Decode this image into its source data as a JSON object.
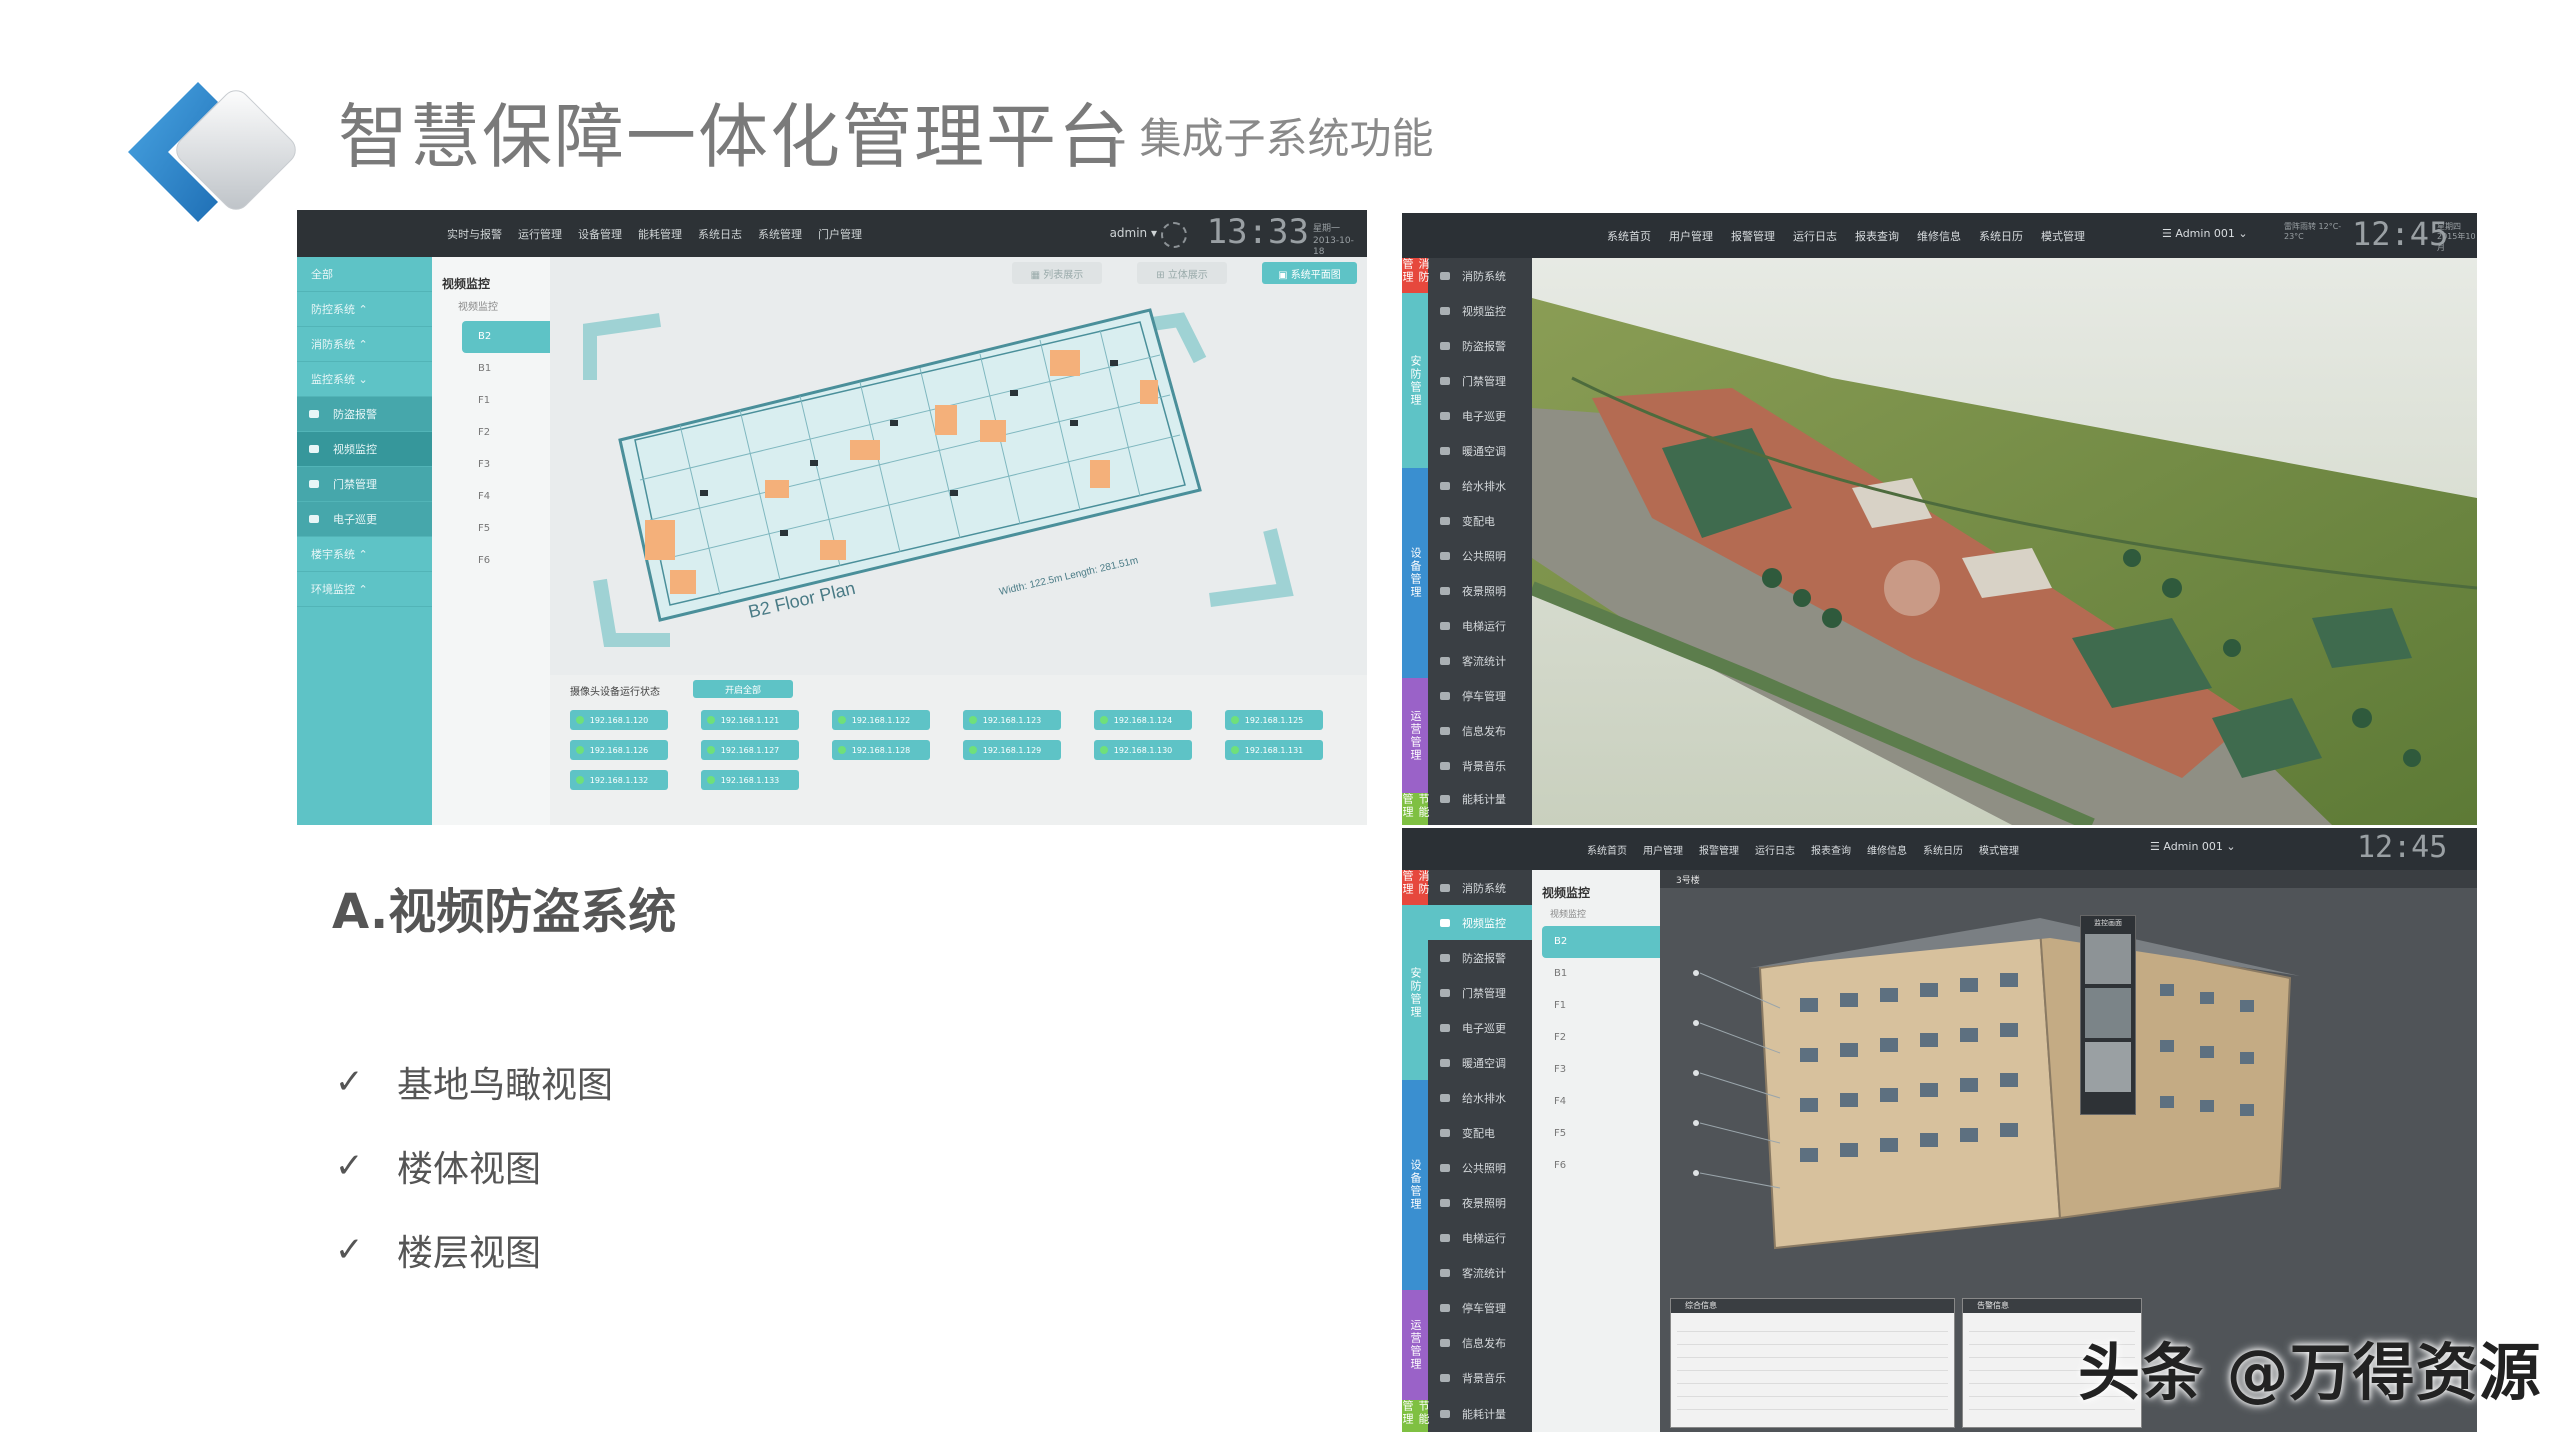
{
  "slide": {
    "title": "智慧保障一体化管理平台",
    "subtitle": "- 集成子系统功能",
    "section_heading": "A.视频防盗系统",
    "bullets": [
      {
        "check": "✓",
        "text": "基地鸟瞰视图"
      },
      {
        "check": "✓",
        "text": "楼体视图"
      },
      {
        "check": "✓",
        "text": "楼层视图"
      }
    ],
    "watermark": "头条 @万得资源",
    "colors": {
      "teal": "#5ec3c6",
      "logo_blue": "#3a8fd0",
      "dark_bar": "#2d3236"
    }
  },
  "shot1": {
    "menu": [
      "实时与报警",
      "运行管理",
      "设备管理",
      "能耗管理",
      "系统日志",
      "系统管理",
      "门户管理"
    ],
    "admin": "admin ▾",
    "time": "13:33",
    "date": "星期一 2013-10-18",
    "sidebar": [
      {
        "label": "全部",
        "type": "top"
      },
      {
        "label": "防控系统 ⌃",
        "type": "top"
      },
      {
        "label": "消防系统 ⌃",
        "type": "top"
      },
      {
        "label": "监控系统 ⌄",
        "type": "top"
      },
      {
        "label": "防盗报警",
        "type": "sub"
      },
      {
        "label": "视频监控",
        "type": "active"
      },
      {
        "label": "门禁管理",
        "type": "sub"
      },
      {
        "label": "电子巡更",
        "type": "sub"
      },
      {
        "label": "楼宇系统 ⌃",
        "type": "top"
      },
      {
        "label": "环境监控 ⌃",
        "type": "top"
      }
    ],
    "floors_header": "视频监控",
    "floors_subheader": "视频监控",
    "floors": [
      "B2",
      "B1",
      "F1",
      "F2",
      "F3",
      "F4",
      "F5",
      "F6"
    ],
    "btn_a": "▦  列表展示",
    "btn_b": "⊞  立体展示",
    "btn_c": "▣  系统平面图",
    "plan_label": "B2 Floor Plan",
    "plan_dims": "Width: 122.5m  Length: 281.51m",
    "bottom_label": "摄像头设备运行状态",
    "all_button": "开启全部",
    "cameras": [
      "192.168.1.120",
      "192.168.1.121",
      "192.168.1.122",
      "192.168.1.123",
      "192.168.1.124",
      "192.168.1.125",
      "192.168.1.126",
      "192.168.1.127",
      "192.168.1.128",
      "192.168.1.129",
      "192.168.1.130",
      "192.168.1.131",
      "192.168.1.132",
      "192.168.1.133"
    ]
  },
  "shot2": {
    "menu": [
      "系统首页",
      "用户管理",
      "报警管理",
      "运行日志",
      "报表查询",
      "维修信息",
      "系统日历",
      "模式管理"
    ],
    "admin": "☰  Admin 001 ⌄",
    "weather": "雷阵雨转 12°C-23°C",
    "time": "12:45",
    "date": "星期四 2015年10月",
    "categories": [
      {
        "label": "消防管理",
        "color": "#e6483d"
      },
      {
        "label": "安防管理",
        "color": "#5ec3c6"
      },
      {
        "label": "设备管理",
        "color": "#3a8fd0"
      },
      {
        "label": "运营管理",
        "color": "#9a62c8"
      },
      {
        "label": "节能管理",
        "color": "#7fc042"
      }
    ],
    "sidebar": [
      "消防系统",
      "视频监控",
      "防盗报警",
      "门禁管理",
      "电子巡更",
      "暖通空调",
      "给水排水",
      "变配电",
      "公共照明",
      "夜景照明",
      "电梯运行",
      "客流统计",
      "停车管理",
      "信息发布",
      "背景音乐",
      "能耗计量"
    ]
  },
  "shot3": {
    "menu": [
      "系统首页",
      "用户管理",
      "报警管理",
      "运行日志",
      "报表查询",
      "维修信息",
      "系统日历",
      "模式管理"
    ],
    "admin": "☰  Admin 001 ⌄",
    "time": "12:45",
    "sidebar": [
      "消防系统",
      "视频监控",
      "防盗报警",
      "门禁管理",
      "电子巡更",
      "暖通空调",
      "给水排水",
      "变配电",
      "公共照明",
      "夜景照明",
      "电梯运行",
      "客流统计",
      "停车管理",
      "信息发布",
      "背景音乐",
      "能耗计量"
    ],
    "floors_header": "视频监控",
    "floors_subheader": "视频监控",
    "floors": [
      "B2",
      "B1",
      "F1",
      "F2",
      "F3",
      "F4",
      "F5",
      "F6"
    ],
    "tab": "3号楼",
    "preview_title": "监控画面",
    "panel_left": "综合信息",
    "panel_right": "告警信息"
  }
}
